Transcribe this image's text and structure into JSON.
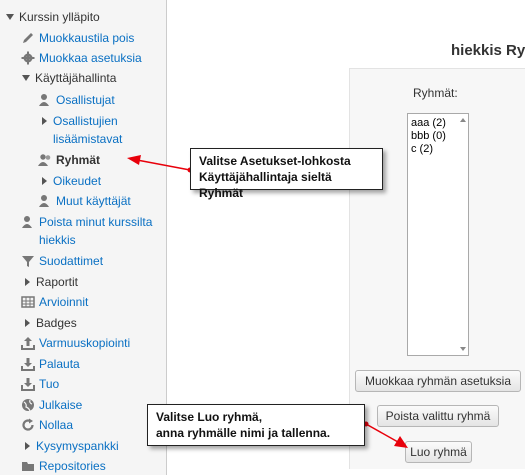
{
  "sidebar": {
    "items": [
      {
        "label": "Kurssin ylläpito",
        "icon": "expanded-triangle-icon"
      },
      {
        "label": "Muokkaustila pois",
        "icon": "pencil-icon"
      },
      {
        "label": "Muokkaa asetuksia",
        "icon": "gear-icon"
      },
      {
        "label": "Käyttäjähallinta",
        "icon": "expanded-triangle-icon"
      },
      {
        "label": "Osallistujat",
        "icon": "user-icon"
      },
      {
        "label": "Osallistujien lisäämistavat",
        "icon": "collapsed-triangle-icon"
      },
      {
        "label": "Ryhmät",
        "icon": "users-group-icon"
      },
      {
        "label": "Oikeudet",
        "icon": "collapsed-triangle-icon"
      },
      {
        "label": "Muut käyttäjät",
        "icon": "user-icon"
      },
      {
        "label": "Poista minut kurssilta hiekkis",
        "icon": "user-remove-icon"
      },
      {
        "label": "Suodattimet",
        "icon": "filter-icon"
      },
      {
        "label": "Raportit",
        "icon": "collapsed-triangle-icon"
      },
      {
        "label": "Arvioinnit",
        "icon": "grid-icon"
      },
      {
        "label": "Badges",
        "icon": "collapsed-triangle-icon"
      },
      {
        "label": "Varmuuskopiointi",
        "icon": "upload-icon"
      },
      {
        "label": "Palauta",
        "icon": "download-icon"
      },
      {
        "label": "Tuo",
        "icon": "import-icon"
      },
      {
        "label": "Julkaise",
        "icon": "globe-icon"
      },
      {
        "label": "Nollaa",
        "icon": "reset-icon"
      },
      {
        "label": "Kysymyspankki",
        "icon": "collapsed-triangle-icon"
      },
      {
        "label": "Repositories",
        "icon": "folder-icon"
      }
    ]
  },
  "main": {
    "title": "hiekkis Ry",
    "groups_label": "Ryhmät:",
    "groups": [
      "aaa (2)",
      "bbb (0)",
      "c (2)"
    ],
    "buttons": {
      "edit_group": "Muokkaa ryhmän asetuksia",
      "delete_group": "Poista valittu ryhmä",
      "create_group": "Luo ryhmä"
    }
  },
  "callouts": {
    "groups_hint_line1": "Valitse Asetukset-lohkosta",
    "groups_hint_line2": "Käyttäjähallintaja sieltä Ryhmät",
    "create_hint_line1": "Valitse Luo ryhmä,",
    "create_hint_line2": "anna ryhmälle nimi ja tallenna."
  },
  "colors": {
    "link": "#0a70c3",
    "arrow": "#e8000b"
  }
}
